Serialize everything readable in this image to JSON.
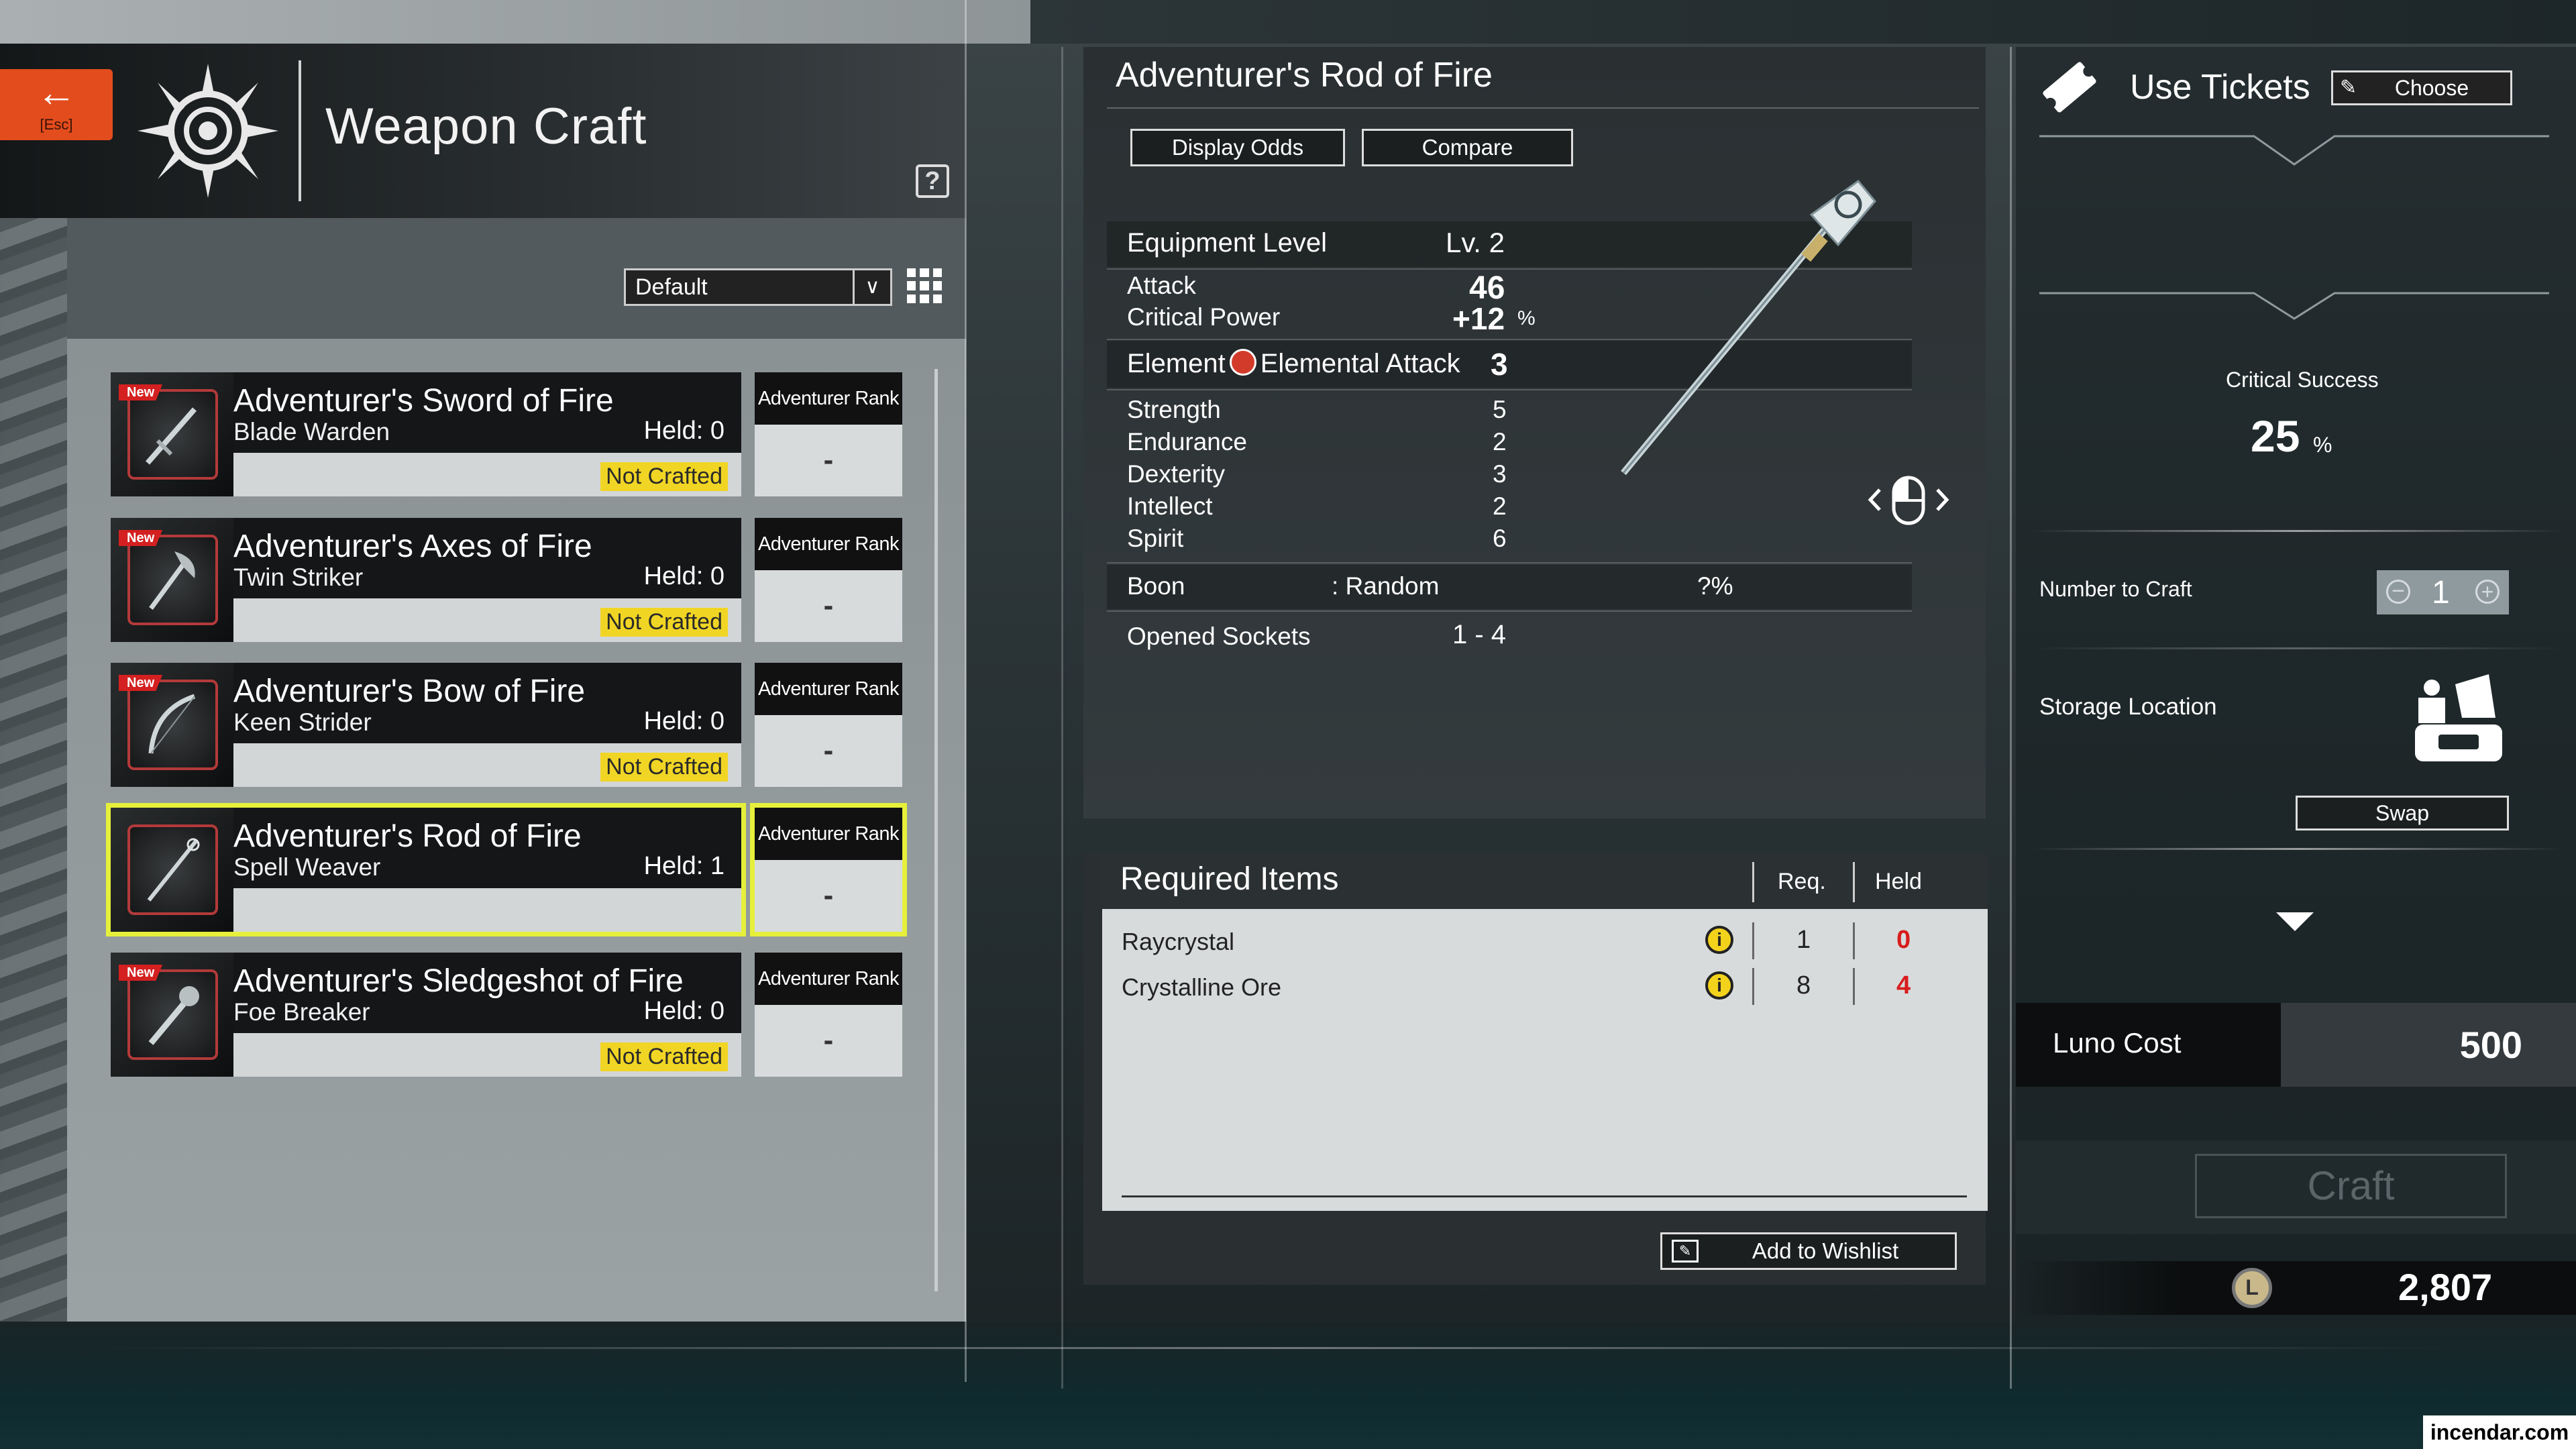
{
  "header": {
    "esc_label": "[Esc]",
    "title": "Weapon Craft",
    "help": "?"
  },
  "sort": {
    "selected": "Default"
  },
  "items": [
    {
      "name": "Adventurer's Sword of Fire",
      "class": "Blade Warden",
      "held": "Held: 0",
      "status": "Not Crafted",
      "new": "New",
      "rank_label": "Adventurer Rank",
      "rank": "-"
    },
    {
      "name": "Adventurer's Axes of Fire",
      "class": "Twin Striker",
      "held": "Held: 0",
      "status": "Not Crafted",
      "new": "New",
      "rank_label": "Adventurer Rank",
      "rank": "-"
    },
    {
      "name": "Adventurer's Bow of Fire",
      "class": "Keen Strider",
      "held": "Held: 0",
      "status": "Not Crafted",
      "new": "New",
      "rank_label": "Adventurer Rank",
      "rank": "-"
    },
    {
      "name": "Adventurer's Rod of Fire",
      "class": "Spell Weaver",
      "held": "Held: 1",
      "status": "",
      "new": "",
      "rank_label": "Adventurer Rank",
      "rank": "-"
    },
    {
      "name": "Adventurer's Sledgeshot of Fire",
      "class": "Foe Breaker",
      "held": "Held: 0",
      "status": "Not Crafted",
      "new": "New",
      "rank_label": "Adventurer Rank",
      "rank": "-"
    }
  ],
  "detail": {
    "title": "Adventurer's Rod of Fire",
    "display_odds": "Display Odds",
    "compare": "Compare",
    "equip_level_label": "Equipment Level",
    "equip_level": "Lv. 2",
    "attack_label": "Attack",
    "attack": "46",
    "crit_label": "Critical Power",
    "crit": "+12",
    "crit_unit": "%",
    "element_label": "Element",
    "element_type": "Elemental Attack",
    "element_value": "3",
    "stats": [
      {
        "label": "Strength",
        "value": "5"
      },
      {
        "label": "Endurance",
        "value": "2"
      },
      {
        "label": "Dexterity",
        "value": "3"
      },
      {
        "label": "Intellect",
        "value": "2"
      },
      {
        "label": "Spirit",
        "value": "6"
      }
    ],
    "boon_label": "Boon",
    "boon_value": ": Random",
    "boon_pct": "?%",
    "sockets_label": "Opened Sockets",
    "sockets": "1 - 4"
  },
  "required": {
    "title": "Required Items",
    "req_label": "Req.",
    "held_label": "Held",
    "rows": [
      {
        "name": "Raycrystal",
        "req": "1",
        "held": "0"
      },
      {
        "name": "Crystalline Ore",
        "req": "8",
        "held": "4"
      }
    ],
    "wishlist": "Add to Wishlist"
  },
  "right": {
    "use_tickets": "Use Tickets",
    "choose": "Choose",
    "crit_success_label": "Critical Success",
    "crit_success": "25",
    "crit_success_unit": "%",
    "number_label": "Number to Craft",
    "number": "1",
    "storage_label": "Storage Location",
    "swap": "Swap",
    "luno_label": "Luno Cost",
    "luno_cost": "500",
    "craft": "Craft",
    "currency": "2,807",
    "coin_letter": "L"
  },
  "watermark": "incendar.com",
  "colors": {
    "accent": "#e34c1c",
    "selected": "#e6f03b",
    "not_crafted": "#f1d524",
    "shortage": "#d81c1c"
  }
}
